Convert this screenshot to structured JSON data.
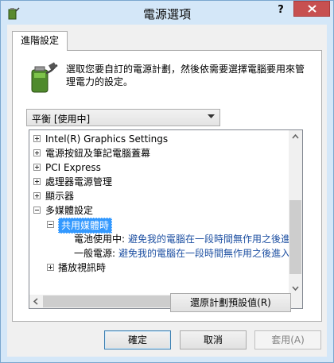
{
  "window": {
    "title": "電源選項",
    "help_label": "?"
  },
  "tab": {
    "label": "進階設定"
  },
  "description": "選取您要自訂的電源計劃，然後依需要選擇電腦要用來管理電力的設定。",
  "plan_dropdown": {
    "value": "平衡 [使用中]"
  },
  "tree": {
    "items": [
      {
        "label": "Intel(R) Graphics Settings"
      },
      {
        "label": "電源按鈕及筆記電腦蓋幕"
      },
      {
        "label": "PCI Express"
      },
      {
        "label": "處理器電源管理"
      },
      {
        "label": "顯示器"
      },
      {
        "label": "多媒體設定"
      },
      {
        "label": "共用媒體時"
      },
      {
        "label": "電池使用中:",
        "value": "避免我的電腦在一段時間無作用之後進"
      },
      {
        "label": "一般電源:",
        "value": "避免我的電腦在一段時間無作用之後進入"
      },
      {
        "label": "播放視訊時"
      }
    ]
  },
  "buttons": {
    "restore": "還原計劃預設值(R)",
    "ok": "確定",
    "cancel": "取消",
    "apply": "套用(A)"
  },
  "colors": {
    "close": "#c75050",
    "selection": "#3399ff",
    "link_text": "#1e50a2"
  }
}
